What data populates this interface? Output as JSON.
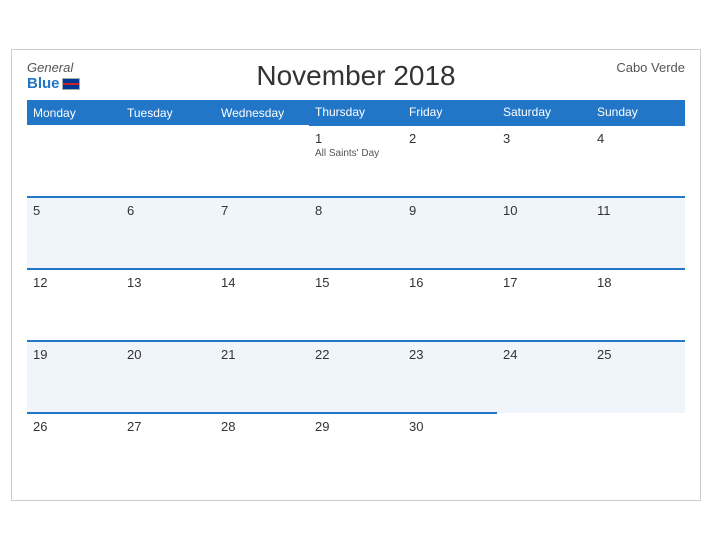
{
  "header": {
    "brand_general": "General",
    "brand_blue": "Blue",
    "title": "November 2018",
    "country": "Cabo Verde"
  },
  "weekdays": [
    "Monday",
    "Tuesday",
    "Wednesday",
    "Thursday",
    "Friday",
    "Saturday",
    "Sunday"
  ],
  "weeks": [
    [
      {
        "day": "",
        "holiday": ""
      },
      {
        "day": "",
        "holiday": ""
      },
      {
        "day": "",
        "holiday": ""
      },
      {
        "day": "1",
        "holiday": "All Saints' Day"
      },
      {
        "day": "2",
        "holiday": ""
      },
      {
        "day": "3",
        "holiday": ""
      },
      {
        "day": "4",
        "holiday": ""
      }
    ],
    [
      {
        "day": "5",
        "holiday": ""
      },
      {
        "day": "6",
        "holiday": ""
      },
      {
        "day": "7",
        "holiday": ""
      },
      {
        "day": "8",
        "holiday": ""
      },
      {
        "day": "9",
        "holiday": ""
      },
      {
        "day": "10",
        "holiday": ""
      },
      {
        "day": "11",
        "holiday": ""
      }
    ],
    [
      {
        "day": "12",
        "holiday": ""
      },
      {
        "day": "13",
        "holiday": ""
      },
      {
        "day": "14",
        "holiday": ""
      },
      {
        "day": "15",
        "holiday": ""
      },
      {
        "day": "16",
        "holiday": ""
      },
      {
        "day": "17",
        "holiday": ""
      },
      {
        "day": "18",
        "holiday": ""
      }
    ],
    [
      {
        "day": "19",
        "holiday": ""
      },
      {
        "day": "20",
        "holiday": ""
      },
      {
        "day": "21",
        "holiday": ""
      },
      {
        "day": "22",
        "holiday": ""
      },
      {
        "day": "23",
        "holiday": ""
      },
      {
        "day": "24",
        "holiday": ""
      },
      {
        "day": "25",
        "holiday": ""
      }
    ],
    [
      {
        "day": "26",
        "holiday": ""
      },
      {
        "day": "27",
        "holiday": ""
      },
      {
        "day": "28",
        "holiday": ""
      },
      {
        "day": "29",
        "holiday": ""
      },
      {
        "day": "30",
        "holiday": ""
      },
      {
        "day": "",
        "holiday": ""
      },
      {
        "day": "",
        "holiday": ""
      }
    ]
  ]
}
